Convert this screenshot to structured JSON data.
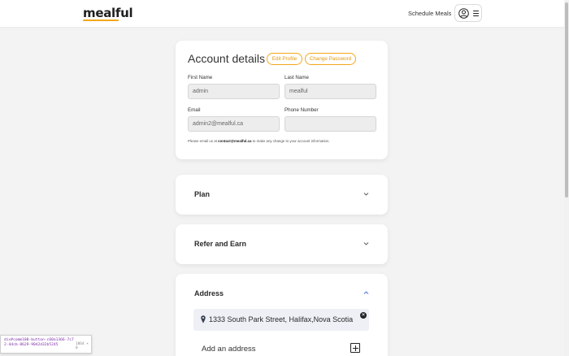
{
  "header": {
    "logo_text": "mealful",
    "schedule_meals_label": "Schedule Meals",
    "user_icon": "user-circle-icon",
    "menu_icon": "hamburger-icon"
  },
  "account": {
    "title": "Account details",
    "edit_profile_label": "Edit Profile",
    "change_password_label": "Change Password",
    "first_name_label": "First Name",
    "first_name_value": "admin",
    "last_name_label": "Last Name",
    "last_name_value": "mealful",
    "email_label": "Email",
    "email_value": "admin2@mealful.ca",
    "phone_label": "Phone Number",
    "phone_value": "",
    "note_prefix": "Please email us at ",
    "note_email": "contact@mealful.ca",
    "note_suffix": " to make any change to your account information."
  },
  "plan": {
    "title": "Plan",
    "icon": "chevron-down-icon"
  },
  "refer": {
    "title": "Refer and Earn",
    "icon": "chevron-down-icon"
  },
  "address": {
    "title": "Address",
    "icon": "chevron-up-icon",
    "items": [
      {
        "text": "1333 South Park Street, Halifax,Nova Scotia",
        "icon": "map-pin-icon",
        "remove_icon": "close-circle-icon"
      }
    ],
    "add_label": "Add an address",
    "add_icon": "plus-square-icon"
  },
  "debug_tooltip": {
    "selector": "div#comm100-button-c60a1366-7c72-4dcb-8629-9042d32b5245",
    "dimensions": "1064 × 0"
  },
  "colors": {
    "accent": "#f2a71b",
    "page_background": "#f3f3f3",
    "input_background": "#ededed",
    "address_row_background": "#eef0f6"
  }
}
